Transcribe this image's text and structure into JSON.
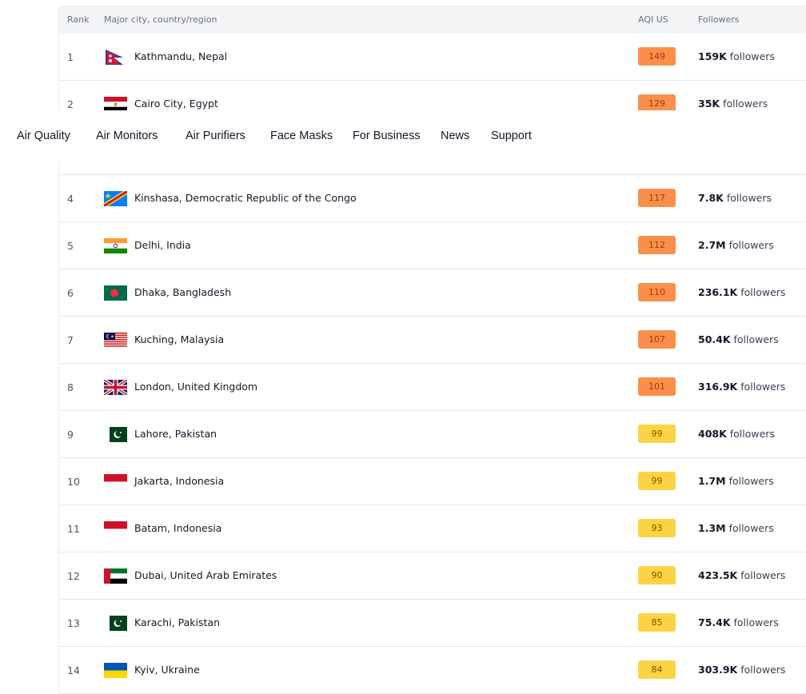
{
  "table": {
    "headers": {
      "rank": "Rank",
      "city": "Major city, country/region",
      "aqi": "AQI US",
      "followers": "Followers"
    },
    "rows": [
      {
        "rank": "1",
        "flag": "nepal",
        "city": "Kathmandu, Nepal",
        "aqi": "149",
        "level": "orange",
        "followers_count": "159K",
        "followers_suffix": " followers"
      },
      {
        "rank": "2",
        "flag": "egypt",
        "city": "Cairo City, Egypt",
        "aqi": "129",
        "level": "orange",
        "followers_count": "35K",
        "followers_suffix": " followers"
      },
      null,
      {
        "rank": "4",
        "flag": "drc",
        "city": "Kinshasa, Democratic Republic of the Congo",
        "aqi": "117",
        "level": "orange",
        "followers_count": "7.8K",
        "followers_suffix": " followers"
      },
      {
        "rank": "5",
        "flag": "india",
        "city": "Delhi, India",
        "aqi": "112",
        "level": "orange",
        "followers_count": "2.7M",
        "followers_suffix": " followers"
      },
      {
        "rank": "6",
        "flag": "bangladesh",
        "city": "Dhaka, Bangladesh",
        "aqi": "110",
        "level": "orange",
        "followers_count": "236.1K",
        "followers_suffix": " followers"
      },
      {
        "rank": "7",
        "flag": "malaysia",
        "city": "Kuching, Malaysia",
        "aqi": "107",
        "level": "orange",
        "followers_count": "50.4K",
        "followers_suffix": " followers"
      },
      {
        "rank": "8",
        "flag": "uk",
        "city": "London, United Kingdom",
        "aqi": "101",
        "level": "orange",
        "followers_count": "316.9K",
        "followers_suffix": " followers"
      },
      {
        "rank": "9",
        "flag": "pakistan",
        "city": "Lahore, Pakistan",
        "aqi": "99",
        "level": "yellow",
        "followers_count": "408K",
        "followers_suffix": " followers"
      },
      {
        "rank": "10",
        "flag": "indonesia",
        "city": "Jakarta, Indonesia",
        "aqi": "99",
        "level": "yellow",
        "followers_count": "1.7M",
        "followers_suffix": " followers"
      },
      {
        "rank": "11",
        "flag": "indonesia",
        "city": "Batam, Indonesia",
        "aqi": "93",
        "level": "yellow",
        "followers_count": "1.3M",
        "followers_suffix": " followers"
      },
      {
        "rank": "12",
        "flag": "uae",
        "city": "Dubai, United Arab Emirates",
        "aqi": "90",
        "level": "yellow",
        "followers_count": "423.5K",
        "followers_suffix": " followers"
      },
      {
        "rank": "13",
        "flag": "pakistan",
        "city": "Karachi, Pakistan",
        "aqi": "85",
        "level": "yellow",
        "followers_count": "75.4K",
        "followers_suffix": " followers"
      },
      {
        "rank": "14",
        "flag": "ukraine",
        "city": "Kyiv, Ukraine",
        "aqi": "84",
        "level": "yellow",
        "followers_count": "303.9K",
        "followers_suffix": " followers"
      }
    ]
  },
  "colors": {
    "orange": {
      "bg": "#fb8f4a",
      "text": "#9a3a1a"
    },
    "yellow": {
      "bg": "#fdd344",
      "text": "#7a5a00"
    }
  },
  "nav": {
    "items": [
      "Air Quality",
      "Air Monitors",
      "Air Purifiers",
      "Face Masks",
      "For Business",
      "News",
      "Support"
    ]
  }
}
